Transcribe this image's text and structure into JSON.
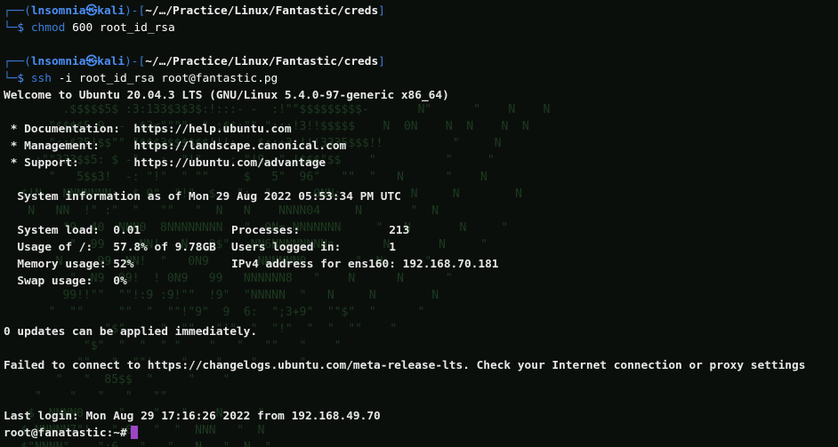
{
  "prompt": {
    "user": "lnsomnia",
    "at": "㉿",
    "host": "kali",
    "path": "~/…/Practice/Linux/Fantastic/creds"
  },
  "commands": [
    {
      "cmd": "chmod",
      "args": "600 root_id_rsa"
    },
    {
      "cmd": "ssh",
      "args": "-i root_id_rsa root@fantastic.pg"
    }
  ],
  "welcome": "Welcome to Ubuntu 20.04.3 LTS (GNU/Linux 5.4.0-97-generic x86_64)",
  "links": [
    {
      "label": " * Documentation:  ",
      "url": "https://help.ubuntu.com"
    },
    {
      "label": " * Management:     ",
      "url": "https://landscape.canonical.com"
    },
    {
      "label": " * Support:        ",
      "url": "https://ubuntu.com/advantage"
    }
  ],
  "sysinfo_header": "  System information as of Mon 29 Aug 2022 05:53:34 PM UTC",
  "sysinfo": [
    {
      "l1": "  System load:  ",
      "v1": "0.01",
      "l2": "Processes:             ",
      "v2": "213"
    },
    {
      "l1": "  Usage of /:   ",
      "v1": "57.8% of 9.78GB",
      "l2": "Users logged in:       ",
      "v2": "1"
    },
    {
      "l1": "  Memory usage: ",
      "v1": "52%",
      "l2": "IPv4 address for ens160:",
      "v2": " 192.168.70.181"
    },
    {
      "l1": "  Swap usage:   ",
      "v1": "0%",
      "l2": "",
      "v2": ""
    }
  ],
  "updates": "0 updates can be applied immediately.",
  "failed": "Failed to connect to https://changelogs.ubuntu.com/meta-release-lts. Check your Internet connection or proxy settings",
  "last_login": "Last login: Mon Aug 29 17:16:26 2022 from 192.168.49.70",
  "final_prompt": "root@fanatastic:~#",
  "colors": {
    "background": "#0b0f0c",
    "prompt_blue": "#4b8ef5",
    "cursor": "#9d45c7",
    "matrix_green": "#1d3a1f"
  }
}
